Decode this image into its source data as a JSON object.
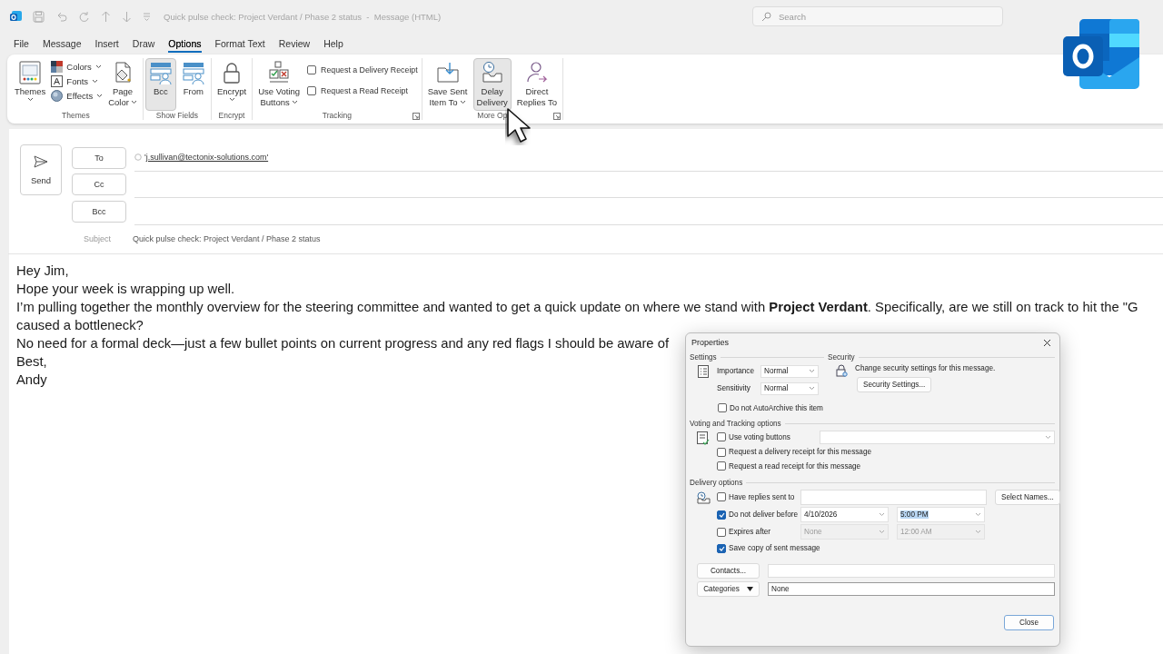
{
  "window": {
    "title": "Quick pulse check: Project Verdant / Phase 2 status  -  Message (HTML)",
    "search_placeholder": "Search"
  },
  "tabs": [
    {
      "label": "File",
      "selected": false
    },
    {
      "label": "Message",
      "selected": false
    },
    {
      "label": "Insert",
      "selected": false
    },
    {
      "label": "Draw",
      "selected": false
    },
    {
      "label": "Options",
      "selected": true
    },
    {
      "label": "Format Text",
      "selected": false
    },
    {
      "label": "Review",
      "selected": false
    },
    {
      "label": "Help",
      "selected": false
    }
  ],
  "ribbon": {
    "groups": [
      {
        "label": "Themes",
        "launcher": false,
        "items": [
          {
            "kind": "large",
            "label": "Themes",
            "dropdown": true,
            "selected": false
          },
          {
            "kind": "stack",
            "items": [
              {
                "label": "Colors",
                "dropdown": true
              },
              {
                "label": "Fonts",
                "dropdown": true
              },
              {
                "label": "Effects",
                "dropdown": true
              }
            ]
          },
          {
            "kind": "large",
            "label": "Page\nColor",
            "dropdown": true,
            "selected": false
          }
        ]
      },
      {
        "label": "Show Fields",
        "launcher": false,
        "items": [
          {
            "kind": "large",
            "label": "Bcc",
            "dropdown": false,
            "selected": true
          },
          {
            "kind": "large",
            "label": "From",
            "dropdown": false,
            "selected": false
          }
        ]
      },
      {
        "label": "Encrypt",
        "launcher": false,
        "items": [
          {
            "kind": "large",
            "label": "Encrypt",
            "dropdown": true,
            "selected": false
          }
        ]
      },
      {
        "label": "Tracking",
        "launcher": true,
        "items": [
          {
            "kind": "large",
            "label": "Use Voting\nButtons",
            "dropdown": true,
            "selected": false
          },
          {
            "kind": "checks",
            "items": [
              {
                "label": "Request a Delivery Receipt",
                "checked": false
              },
              {
                "label": "Request a Read Receipt",
                "checked": false
              }
            ]
          }
        ]
      },
      {
        "label": "More Op",
        "launcher": true,
        "items": [
          {
            "kind": "large",
            "label": "Save Sent\nItem To",
            "dropdown": true,
            "selected": false
          },
          {
            "kind": "large",
            "label": "Delay\nDelivery",
            "dropdown": false,
            "selected": true
          },
          {
            "kind": "large",
            "label": "Direct\nReplies To",
            "dropdown": false,
            "selected": false
          }
        ]
      }
    ]
  },
  "compose": {
    "send": "Send",
    "recipients": [
      {
        "label": "To",
        "value": "'j.sullivan@tectonix-solutions.com'"
      },
      {
        "label": "Cc"
      },
      {
        "label": "Bcc"
      }
    ],
    "subject_label": "Subject",
    "subject": "Quick pulse check: Project Verdant / Phase 2 status"
  },
  "body": {
    "lines": [
      "Hey Jim,",
      "Hope your week is wrapping up well.",
      "I’m pulling together the monthly overview for the steering committee and wanted to get a quick update on where we stand with **Project Verdant**. Specifically, are we still on track to hit the \"G",
      "caused a bottleneck?",
      "No need for a formal deck—just a few bullet points on current progress and any red flags I should be aware of",
      "Best,",
      "Andy"
    ]
  },
  "dialog": {
    "title": "Properties",
    "settings": {
      "heading": "Settings",
      "fields": [
        {
          "label": "Importance",
          "value": "Normal"
        },
        {
          "label": "Sensitivity",
          "value": "Normal"
        }
      ],
      "autoarchive": {
        "label": "Do not AutoArchive this item",
        "checked": false
      }
    },
    "security": {
      "heading": "Security",
      "text": "Change security settings for this message.",
      "button": "Security Settings..."
    },
    "voting": {
      "heading": "Voting and Tracking options",
      "options": [
        {
          "kind": "dropdown",
          "label": "Use voting buttons",
          "checked": false
        },
        {
          "kind": "plain",
          "label": "Request a delivery receipt for this message",
          "checked": false
        },
        {
          "kind": "plain",
          "label": "Request a read receipt for this message",
          "checked": false
        }
      ]
    },
    "delivery": {
      "heading": "Delivery options",
      "options": [
        {
          "kind": "field",
          "label": "Have replies sent to",
          "checked": false,
          "button": "Select Names..."
        },
        {
          "kind": "datetime",
          "label": "Do not deliver before",
          "checked": true,
          "disabled": false,
          "date": "4/10/2026",
          "time": "5:00 PM",
          "time_highlighted": true
        },
        {
          "kind": "datetime",
          "label": "Expires after",
          "checked": false,
          "disabled": true,
          "date": "None",
          "time": "12:00 AM",
          "time_highlighted": false
        },
        {
          "kind": "plain",
          "label": "Save copy of sent message",
          "checked": true
        }
      ]
    },
    "contacts": {
      "button": "Contacts..."
    },
    "categories": {
      "button": "Categories",
      "value": "None"
    },
    "close": "Close"
  }
}
